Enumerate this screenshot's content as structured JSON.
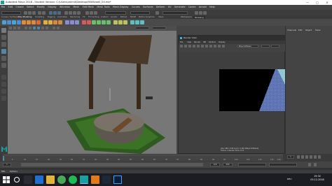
{
  "window": {
    "title": "Autodesk Maya 2018 - Student Version: C:\\Users\\ammit\\Desktop\\MAYA\\well_04.mb*",
    "minimize": "—",
    "maximize": "□",
    "close": "✕"
  },
  "menubar": {
    "items": [
      "File",
      "Edit",
      "Create",
      "Select",
      "Modify",
      "Display",
      "Windows",
      "Mesh",
      "Edit Mesh",
      "Mesh Tools",
      "Mesh Display",
      "Curves",
      "Surfaces",
      "Deform",
      "UV",
      "Generate",
      "Cache",
      "Arnold",
      "Help"
    ]
  },
  "shelf": {
    "tabs": [
      "Curves / Surfaces",
      "Poly Modeling",
      "Sculpting",
      "Rigging",
      "Animation",
      "Rendering",
      "FX",
      "FX Caching",
      "Custom",
      "Arnold",
      "Bifrost",
      "MASH",
      "Motion Graphics",
      "XGen"
    ],
    "workspace": "Modeling",
    "workspace_label": "Workspace:"
  },
  "render_view": {
    "title": "Render View",
    "menu": [
      "File",
      "View",
      "Render",
      "IPR",
      "Options",
      "Display"
    ],
    "renderer": "Maya Software",
    "info_line1": "size: 960 x 540 zoom: 0.164   (Maya Software)",
    "info_line2": "Frame: 1    Render Time: 0:11"
  },
  "channel_box": {
    "tabs": [
      "Channels",
      "Edit",
      "Object",
      "Show"
    ]
  },
  "timeslider": {
    "ticks": [
      "1",
      "5",
      "10",
      "15",
      "20",
      "25",
      "30",
      "35",
      "40",
      "45",
      "50",
      "55",
      "60",
      "65",
      "70",
      "75",
      "80",
      "85",
      "90",
      "95",
      "100",
      "105",
      "110",
      "115",
      "120"
    ],
    "current_frame": "1",
    "range_start": "1",
    "range_end": "120",
    "anim_end": "200"
  },
  "helpline": {
    "mel": "MEL",
    "text": "Options"
  },
  "taskbar": {
    "apps": [
      "start",
      "search",
      "task-view",
      "edge",
      "explorer",
      "chrome",
      "spotify",
      "maya",
      "vlc",
      "steam",
      "photoshop"
    ],
    "time": "19:32",
    "date": "05.12.2018",
    "lang": "DEU"
  },
  "colors": {
    "accent": "#5285a6",
    "maya_teal": "#1a9fa3",
    "viewport_bg": "#777777"
  }
}
